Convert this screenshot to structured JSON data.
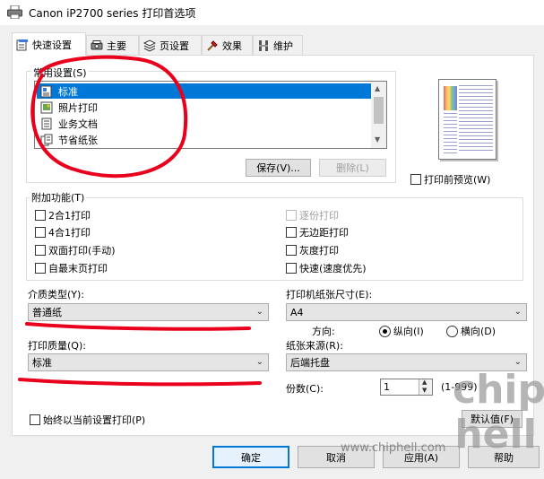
{
  "window": {
    "title": "Canon iP2700 series 打印首选项"
  },
  "tabs": [
    {
      "label": "快速设置",
      "icon": "quick-setup-icon",
      "active": true
    },
    {
      "label": "主要",
      "icon": "main-icon",
      "active": false
    },
    {
      "label": "页设置",
      "icon": "page-setup-icon",
      "active": false
    },
    {
      "label": "效果",
      "icon": "effects-icon",
      "active": false
    },
    {
      "label": "维护",
      "icon": "maintenance-icon",
      "active": false
    }
  ],
  "common_settings": {
    "label": "常用设置(S)",
    "items": [
      {
        "label": "标准",
        "selected": true
      },
      {
        "label": "照片打印",
        "selected": false
      },
      {
        "label": "业务文档",
        "selected": false
      },
      {
        "label": "节省纸张",
        "selected": false
      }
    ],
    "save_label": "保存(V)...",
    "delete_label": "删除(L)"
  },
  "preview": {
    "label": "打印前预览(W)"
  },
  "additional": {
    "label": "附加功能(T)",
    "left": [
      {
        "label": "2合1打印",
        "checked": false,
        "enabled": true
      },
      {
        "label": "4合1打印",
        "checked": false,
        "enabled": true
      },
      {
        "label": "双面打印(手动)",
        "checked": false,
        "enabled": true
      },
      {
        "label": "自最末页打印",
        "checked": false,
        "enabled": true
      }
    ],
    "right": [
      {
        "label": "逐份打印",
        "checked": false,
        "enabled": false
      },
      {
        "label": "无边距打印",
        "checked": false,
        "enabled": true
      },
      {
        "label": "灰度打印",
        "checked": false,
        "enabled": true
      },
      {
        "label": "快速(速度优先)",
        "checked": false,
        "enabled": true
      }
    ]
  },
  "media": {
    "label": "介质类型(Y):",
    "value": "普通纸"
  },
  "quality": {
    "label": "打印质量(Q):",
    "value": "标准"
  },
  "paper_size": {
    "label": "打印机纸张尺寸(E):",
    "value": "A4"
  },
  "orientation": {
    "label": "方向:",
    "options": [
      {
        "label": "纵向(I)",
        "selected": true
      },
      {
        "label": "横向(D)",
        "selected": false
      }
    ]
  },
  "paper_source": {
    "label": "纸张来源(R):",
    "value": "后端托盘"
  },
  "copies": {
    "label": "份数(C):",
    "value": "1",
    "range": "(1-999)"
  },
  "always_print": {
    "label": "始终以当前设置打印(P)"
  },
  "defaults_label": "默认值(F)",
  "buttons": {
    "ok": "确定",
    "cancel": "取消",
    "apply": "应用(A)",
    "help": "帮助"
  },
  "watermark": {
    "url": "www.chiphell.com",
    "logo": "chip hell"
  },
  "colors": {
    "accent": "#0078d7",
    "annotation": "#e8001c"
  }
}
